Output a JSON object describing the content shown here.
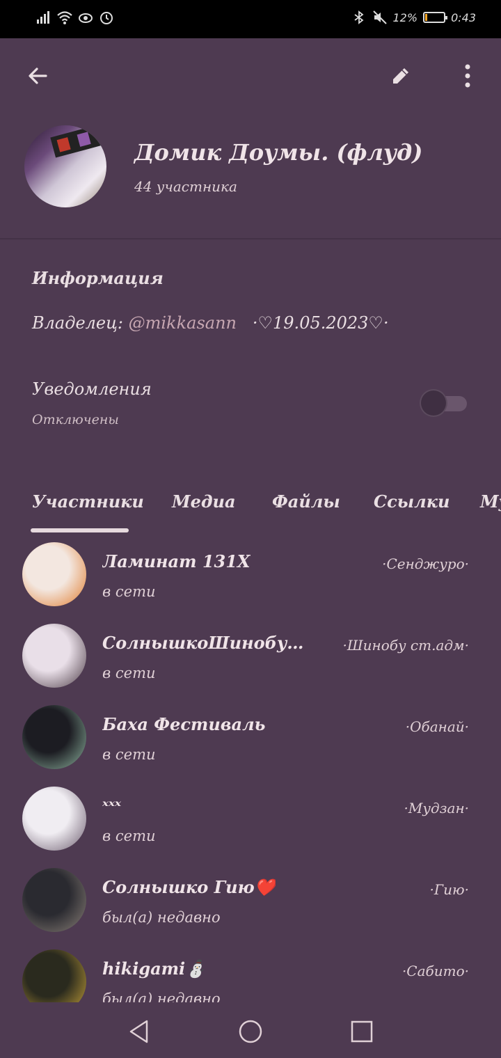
{
  "status_bar": {
    "battery_pct": "12%",
    "time": "0:43",
    "battery_level": 0.12,
    "battery_color": "#f5a623"
  },
  "appbar": {
    "back_icon": "arrow-left-icon",
    "edit_icon": "pencil-icon",
    "more_icon": "more-vertical-icon"
  },
  "group": {
    "title": "Домик Доумы. (флуд)",
    "subtitle": "44 участника"
  },
  "info": {
    "header": "Информация",
    "owner_prefix": "Владелец:",
    "owner_mention": "@mikkasann",
    "owner_suffix": "·♡19.05.2023♡·"
  },
  "notifications": {
    "title": "Уведомления",
    "state": "Отключены",
    "enabled": false
  },
  "tabs": [
    {
      "label": "Участники",
      "active": true
    },
    {
      "label": "Медиа",
      "active": false
    },
    {
      "label": "Файлы",
      "active": false
    },
    {
      "label": "Ссылки",
      "active": false
    },
    {
      "label": "Му",
      "active": false
    }
  ],
  "members": [
    {
      "name": "Ламинат 131X",
      "status": "в сети",
      "role": "·Сенджуро·",
      "avatar_colors": [
        "#f3e7e0",
        "#e07a2b"
      ]
    },
    {
      "name": "СолнышкоШинобушка...",
      "status": "в сети",
      "role": "·Шинобу ст.адм·",
      "avatar_colors": [
        "#e9dfe8",
        "#4a3a44"
      ]
    },
    {
      "name": "Баха Фестиваль",
      "status": "в сети",
      "role": "·Обанай·",
      "avatar_colors": [
        "#1c1c22",
        "#8fb5a0"
      ]
    },
    {
      "name": "ˣˣˣ",
      "status": "в сети",
      "role": "·Мудзан·",
      "avatar_colors": [
        "#f0edf2",
        "#6a5a6c"
      ]
    },
    {
      "name": "Солнышко Гию❤️",
      "status": "был(а) недавно",
      "role": "·Гию·",
      "avatar_colors": [
        "#2a2a30",
        "#8a8078"
      ]
    },
    {
      "name": "hikigami⛄",
      "status": "был(а) недавно",
      "role": "·Сабито·",
      "avatar_colors": [
        "#2a2a1e",
        "#c9a43a"
      ]
    }
  ],
  "nav": {
    "back_icon": "nav-back-triangle-icon",
    "home_icon": "nav-home-circle-icon",
    "recents_icon": "nav-recents-square-icon"
  }
}
